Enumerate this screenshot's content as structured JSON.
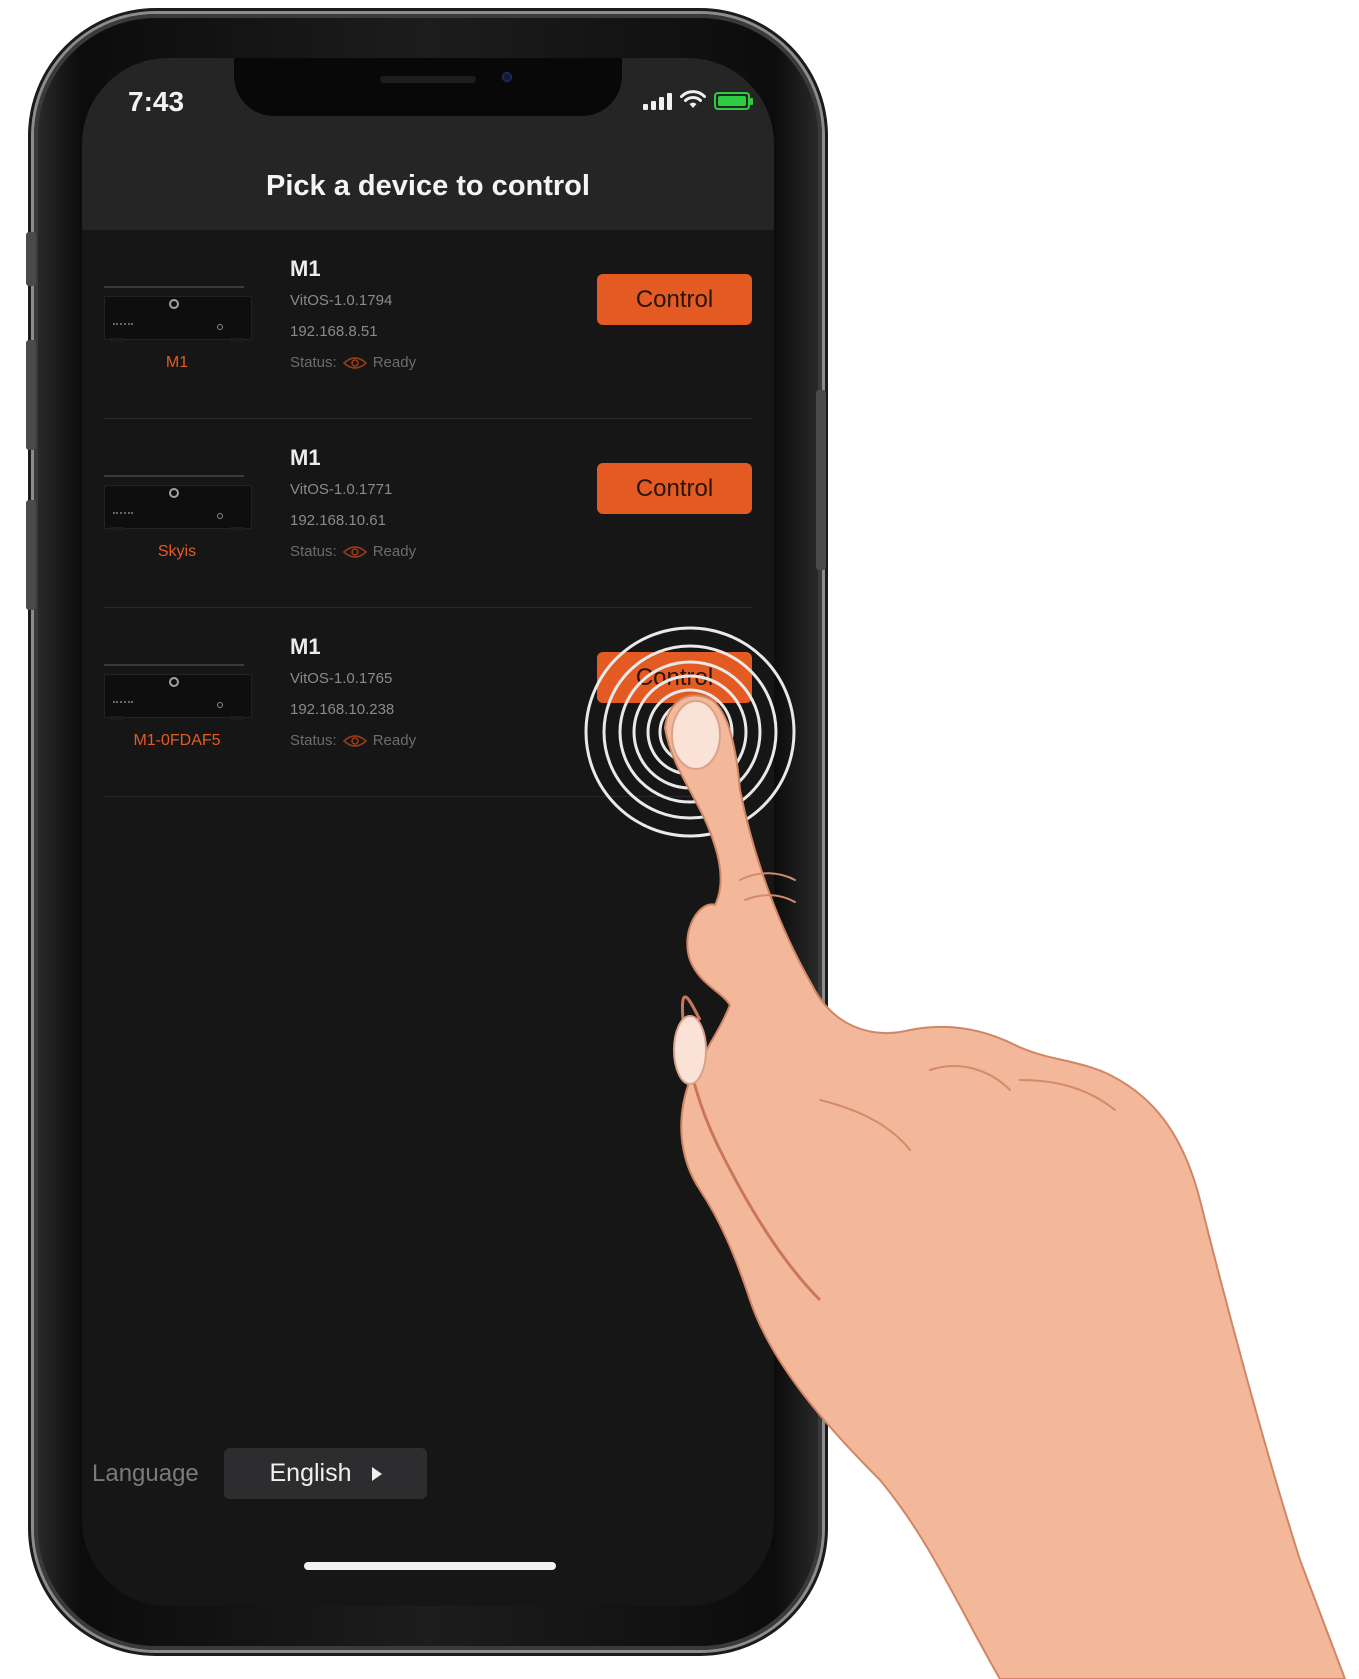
{
  "status_bar": {
    "time": "7:43"
  },
  "header": {
    "title": "Pick a device to control"
  },
  "devices": [
    {
      "thumb_label": "M1",
      "name": "M1",
      "firmware": "VitOS-1.0.1794",
      "ip": "192.168.8.51",
      "status_label": "Status:",
      "status_value": "Ready",
      "button_label": "Control"
    },
    {
      "thumb_label": "Skyis",
      "name": "M1",
      "firmware": "VitOS-1.0.1771",
      "ip": "192.168.10.61",
      "status_label": "Status:",
      "status_value": "Ready",
      "button_label": "Control"
    },
    {
      "thumb_label": "M1-0FDAF5",
      "name": "M1",
      "firmware": "VitOS-1.0.1765",
      "ip": "192.168.10.238",
      "status_label": "Status:",
      "status_value": "Ready",
      "button_label": "Control"
    }
  ],
  "footer": {
    "language_label": "Language",
    "language_value": "English"
  },
  "colors": {
    "accent": "#e35b22",
    "background": "#161616",
    "header": "#252525",
    "battery": "#2ecc40"
  },
  "icons": {
    "eye": "eye-icon",
    "caret": "caret-right-icon",
    "signal": "signal-icon",
    "wifi": "wifi-icon",
    "battery": "battery-icon"
  }
}
